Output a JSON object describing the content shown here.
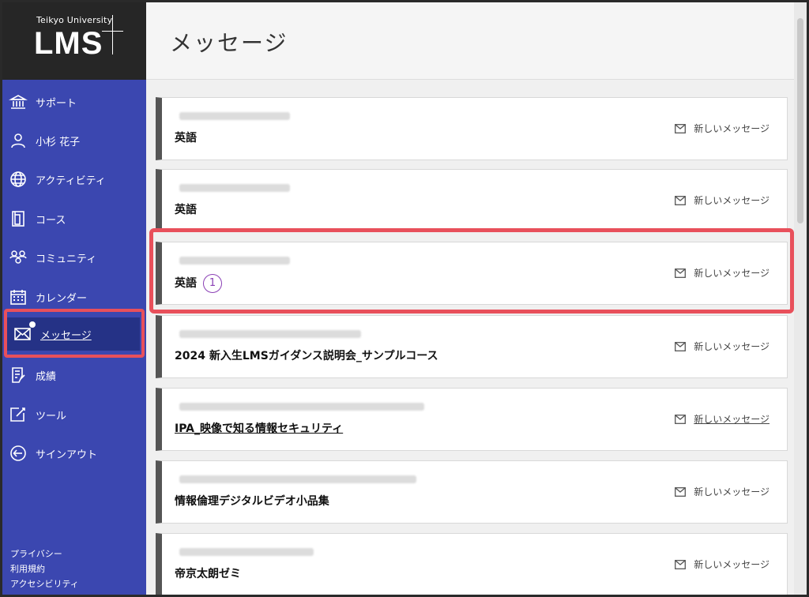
{
  "logo": {
    "small": "Teikyo University",
    "big": "LMS"
  },
  "sidebar": {
    "items": [
      {
        "label": "サポート",
        "icon": "bank-icon"
      },
      {
        "label": "小杉 花子",
        "icon": "user-icon"
      },
      {
        "label": "アクティビティ",
        "icon": "globe-icon"
      },
      {
        "label": "コース",
        "icon": "book-icon"
      },
      {
        "label": "コミュニティ",
        "icon": "community-icon"
      },
      {
        "label": "カレンダー",
        "icon": "calendar-icon"
      },
      {
        "label": "メッセージ",
        "icon": "mail-icon",
        "active": true
      },
      {
        "label": "成績",
        "icon": "grades-icon"
      },
      {
        "label": "ツール",
        "icon": "tools-icon"
      },
      {
        "label": "サインアウト",
        "icon": "signout-icon"
      }
    ],
    "footer": [
      "プライバシー",
      "利用規約",
      "アクセシビリティ"
    ]
  },
  "header": {
    "title": "メッセージ"
  },
  "messages": [
    {
      "title": "英語",
      "action": "新しいメッセージ"
    },
    {
      "title": "英語",
      "action": "新しいメッセージ"
    },
    {
      "title": "英語",
      "badge": "1",
      "action": "新しいメッセージ"
    },
    {
      "title": "2024 新入生LMSガイダンス説明会_サンプルコース",
      "action": "新しいメッセージ"
    },
    {
      "title": "IPA_映像で知る情報セキュリティ",
      "action": "新しいメッセージ"
    },
    {
      "title": "情報倫理デジタルビデオ小品集",
      "action": "新しいメッセージ"
    },
    {
      "title": "帝京太朗ゼミ",
      "action": "新しいメッセージ"
    }
  ],
  "colors": {
    "sidebar": "#3b47b0",
    "active": "#253286",
    "highlight": "#e8505b",
    "badge": "#8a3fb5"
  }
}
